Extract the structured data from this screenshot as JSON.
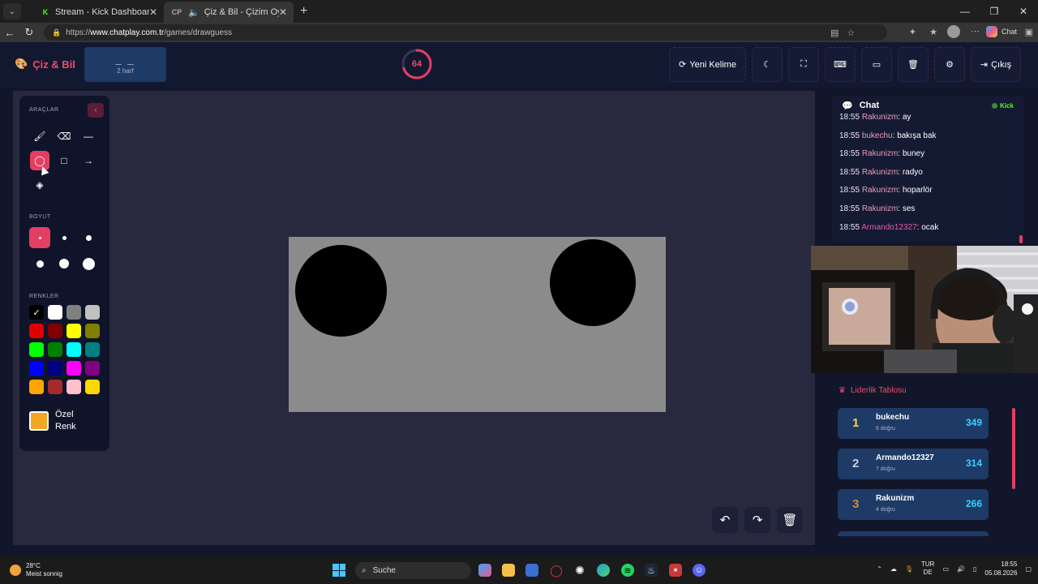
{
  "browser": {
    "tabs": [
      {
        "title": "Stream - Kick Dashboard",
        "favicon": "K",
        "active": false
      },
      {
        "title": "Çiz & Bil - Çizim Oyunu",
        "favicon": "CP",
        "active": true
      }
    ],
    "url": {
      "prefix": "https://",
      "host": "www.chatplay.com.tr",
      "path": "/games/drawguess"
    },
    "copilot_label": "Chat"
  },
  "app": {
    "brand": "Çiz & Bil",
    "word_blanks": "_ _",
    "word_hint": "2 harf",
    "timer": "64",
    "timer_fraction": 0.7,
    "new_word_label": "Yeni Kelime",
    "exit_label": "Çıkış"
  },
  "tools": {
    "section_tools": "ARAÇLAR",
    "section_size": "BOYUT",
    "section_colors": "RENKLER",
    "custom_color_label": "Özel Renk",
    "custom_color": "#f3a623",
    "selected_tool": "circle",
    "colors": [
      "#000000",
      "#ffffff",
      "#808080",
      "#c0c0c0",
      "#e00000",
      "#800000",
      "#ffff00",
      "#808000",
      "#00ff00",
      "#008000",
      "#00ffff",
      "#008080",
      "#0000ff",
      "#000080",
      "#ff00ff",
      "#800080",
      "#ffa500",
      "#a52a2a",
      "#ffc0cb",
      "#ffd700"
    ]
  },
  "chat": {
    "title": "Chat",
    "platform": "Kick",
    "messages": [
      {
        "time": "18:55",
        "user": "Rakunizm",
        "text": "ay"
      },
      {
        "time": "18:55",
        "user": "bukechu",
        "text": "bakışa bak"
      },
      {
        "time": "18:55",
        "user": "Rakunizm",
        "text": "buney"
      },
      {
        "time": "18:55",
        "user": "Rakunizm",
        "text": "radyo"
      },
      {
        "time": "18:55",
        "user": "Rakunizm",
        "text": "hoparlör"
      },
      {
        "time": "18:55",
        "user": "Rakunizm",
        "text": "ses"
      },
      {
        "time": "18:55",
        "user": "Armando12327",
        "text": "ocak"
      }
    ]
  },
  "leaderboard": {
    "title": "Liderlik Tablosu",
    "rows": [
      {
        "rank": "1",
        "name": "bukechu",
        "sub": "6 doğru",
        "score": "349",
        "color": "#f5d742"
      },
      {
        "rank": "2",
        "name": "Armando12327",
        "sub": "7 doğru",
        "score": "314",
        "color": "#c8d0e0"
      },
      {
        "rank": "3",
        "name": "Rakunizm",
        "sub": "4 doğru",
        "score": "266",
        "color": "#d38a3a"
      }
    ]
  },
  "taskbar": {
    "temp": "28°C",
    "weather": "Meist sonnig",
    "search": "Suche",
    "lang1": "TUR",
    "lang2": "DE",
    "time": "18:55",
    "date": "05.08.2026"
  }
}
